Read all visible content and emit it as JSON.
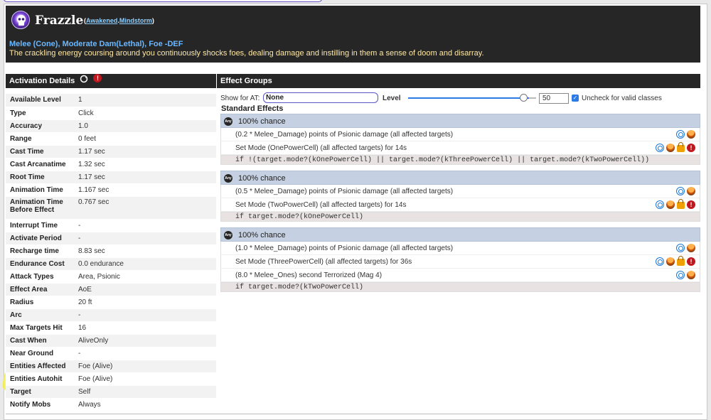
{
  "header": {
    "title": "Frazzle",
    "tags_open": "(",
    "tag1": "Awakened",
    "tag_sep": ".",
    "tag2": "Mindstorm",
    "tags_close": ")",
    "subtitle": "Melee (Cone), Moderate Dam(Lethal), Foe -DEF",
    "description": "The crackling energy coursing around you continuously shocks foes, dealing damage and instilling in them a sense of doom and disarray."
  },
  "activation": {
    "title": "Activation Details",
    "rows": [
      {
        "k": "Available Level",
        "v": "1"
      },
      {
        "k": "Type",
        "v": "Click"
      },
      {
        "k": "Accuracy",
        "v": "1.0"
      },
      {
        "k": "Range",
        "v": "0 feet"
      },
      {
        "k": "Cast Time",
        "v": "1.17 sec"
      },
      {
        "k": "Cast Arcanatime",
        "v": "1.32 sec"
      },
      {
        "k": "Root Time",
        "v": "1.17 sec"
      },
      {
        "k": "Animation Time",
        "v": "1.167 sec"
      },
      {
        "k": "Animation Time Before Effect",
        "v": "0.767 sec"
      },
      {
        "k": "Interrupt Time",
        "v": "-"
      },
      {
        "k": "Activate Period",
        "v": "-"
      },
      {
        "k": "Recharge time",
        "v": "8.83 sec"
      },
      {
        "k": "Endurance Cost",
        "v": "0.0 endurance"
      },
      {
        "k": "Attack Types",
        "v": "Area, Psionic"
      },
      {
        "k": "Effect Area",
        "v": "AoE"
      },
      {
        "k": "Radius",
        "v": "20 ft"
      },
      {
        "k": "Arc",
        "v": "-"
      },
      {
        "k": "Max Targets Hit",
        "v": "16"
      },
      {
        "k": "Cast When",
        "v": "AliveOnly"
      },
      {
        "k": "Near Ground",
        "v": "-"
      },
      {
        "k": "Entities Affected",
        "v": "Foe (Alive)"
      },
      {
        "k": "Entities Autohit",
        "v": "Foe (Alive)"
      },
      {
        "k": "Target",
        "v": "Self"
      },
      {
        "k": "Notify Mobs",
        "v": "Always"
      }
    ]
  },
  "effects": {
    "title": "Effect Groups",
    "show_for_at_label": "Show for AT:",
    "at_value": "None",
    "level_label": "Level",
    "level_value": "50",
    "uncheck_label": "Uncheck for valid classes",
    "standard_label": "Standard Effects",
    "any_icon_text": "Any",
    "groups": [
      {
        "chance": "100% chance",
        "rows": [
          "(0.2 * Melee_Damage) points of Psionic damage (all affected targets)",
          "Set Mode (OnePowerCell) (all affected targets) for 14s"
        ],
        "condition": "if !(target.mode?(kOnePowerCell) || target.mode?(kThreePowerCell) || target.mode?(kTwoPowerCell))"
      },
      {
        "chance": "100% chance",
        "rows": [
          "(0.5 * Melee_Damage) points of Psionic damage (all affected targets)",
          "Set Mode (TwoPowerCell) (all affected targets) for 14s"
        ],
        "condition": "if target.mode?(kOnePowerCell)"
      },
      {
        "chance": "100% chance",
        "rows": [
          "(1.0 * Melee_Damage) points of Psionic damage (all affected targets)",
          "Set Mode (ThreePowerCell) (all affected targets) for 36s",
          "(8.0 * Melee_Ones) second Terrorized (Mag 4)"
        ],
        "condition": "if target.mode?(kTwoPowerCell)"
      }
    ]
  },
  "colors": {
    "header_bg": "#262626",
    "subtitle": "#6bb8ff",
    "description": "#ffe9a6",
    "group_header": "#c5d1e3",
    "highlight": "#f6f22b"
  }
}
